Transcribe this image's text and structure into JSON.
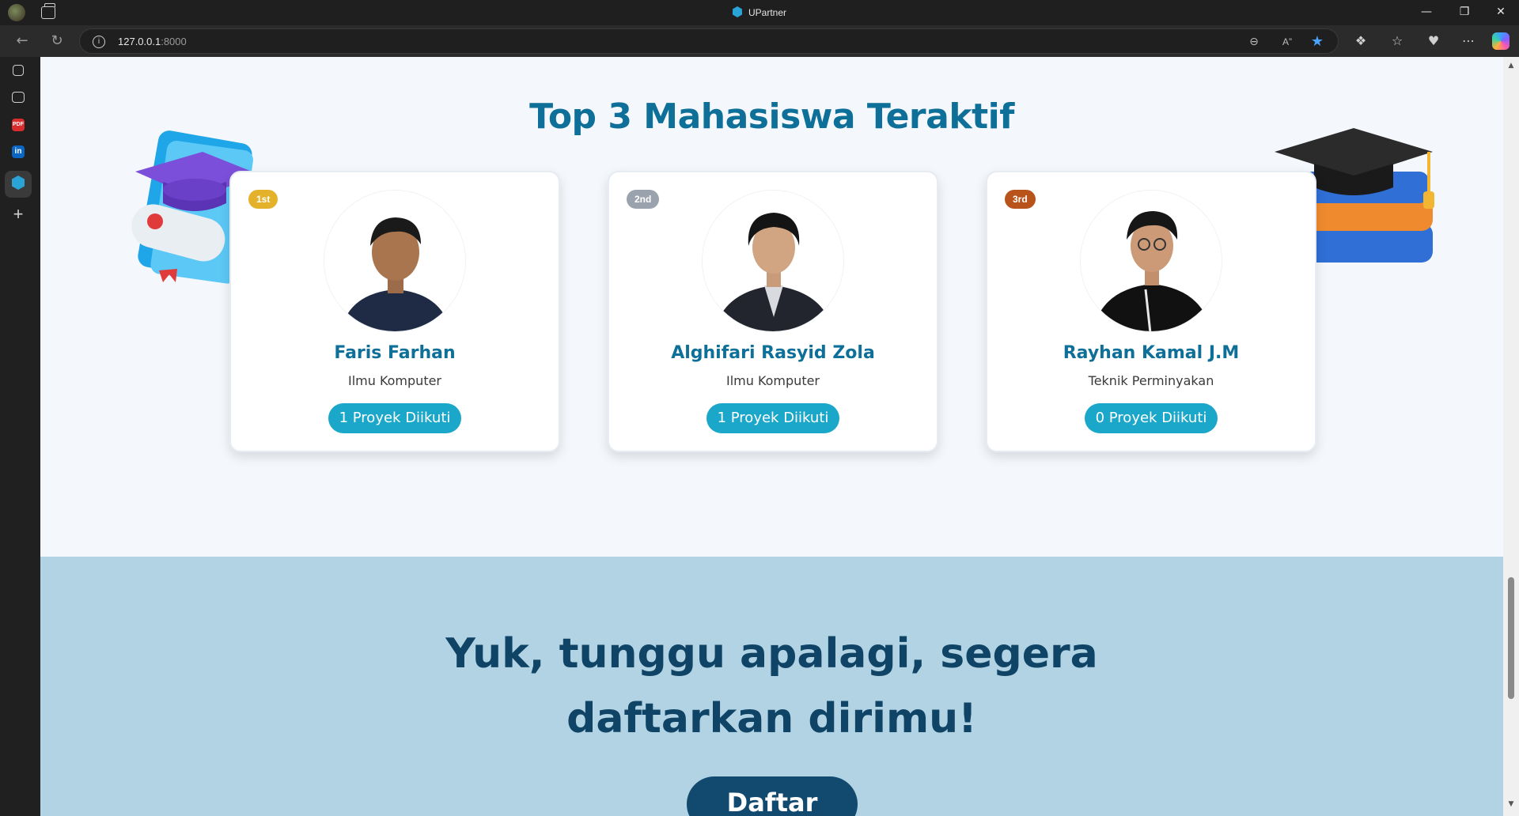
{
  "browser": {
    "window_title": "UPartner",
    "url_host": "127.0.0.1",
    "url_port": ":8000",
    "window_controls": [
      "minimize",
      "restore",
      "close"
    ]
  },
  "sidebar": {
    "items": [
      {
        "icon": "collections-icon"
      },
      {
        "icon": "history-icon"
      },
      {
        "icon": "pdf-icon",
        "label": "PDF"
      },
      {
        "icon": "linkedin-icon",
        "label": "in"
      },
      {
        "icon": "upartner-icon"
      },
      {
        "icon": "add-icon"
      }
    ]
  },
  "section": {
    "title": "Top 3 Mahasiswa Teraktif"
  },
  "students": [
    {
      "rank": "1st",
      "rank_color": "#e3b22a",
      "name": "Faris Farhan",
      "major": "Ilmu Komputer",
      "projects": "1 Proyek Diikuti"
    },
    {
      "rank": "2nd",
      "rank_color": "#9aa3ad",
      "name": "Alghifari Rasyid Zola",
      "major": "Ilmu Komputer",
      "projects": "1 Proyek Diikuti"
    },
    {
      "rank": "3rd",
      "rank_color": "#b8531b",
      "name": "Rayhan Kamal J.M",
      "major": "Teknik Perminyakan",
      "projects": "0 Proyek Diikuti"
    }
  ],
  "cta": {
    "line1": "Yuk, tunggu apalagi, segera",
    "line2": "daftarkan dirimu!",
    "button": "Daftar"
  },
  "colors": {
    "title_blue": "#0e6f98",
    "pill_cyan": "#1aa7c9",
    "cta_bg": "#b1d3e3",
    "cta_text": "#0f4466",
    "cta_button": "#114a6e"
  }
}
